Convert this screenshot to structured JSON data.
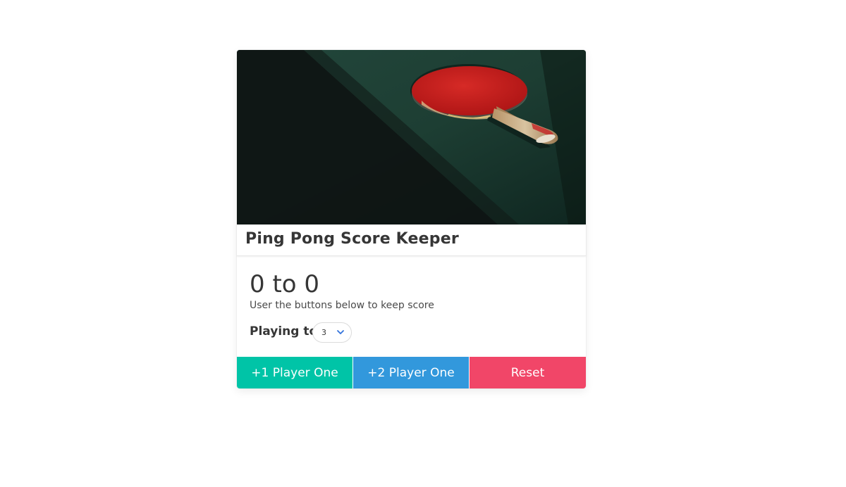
{
  "card": {
    "title": "Ping Pong Score Keeper",
    "image_alt": "ping-pong-paddle-on-table"
  },
  "score": {
    "player_one": 0,
    "player_two": 0,
    "display": "0 to 0",
    "subtitle": "User the buttons below to keep score"
  },
  "playing_to": {
    "label": "Playing to",
    "selected": "3"
  },
  "buttons": {
    "player_one": "+1 Player One",
    "player_two": "+2 Player One",
    "reset": "Reset"
  },
  "colors": {
    "player_one": "#00c4a7",
    "player_two": "#3298dc",
    "reset": "#f14668",
    "accent": "#3273dc"
  }
}
